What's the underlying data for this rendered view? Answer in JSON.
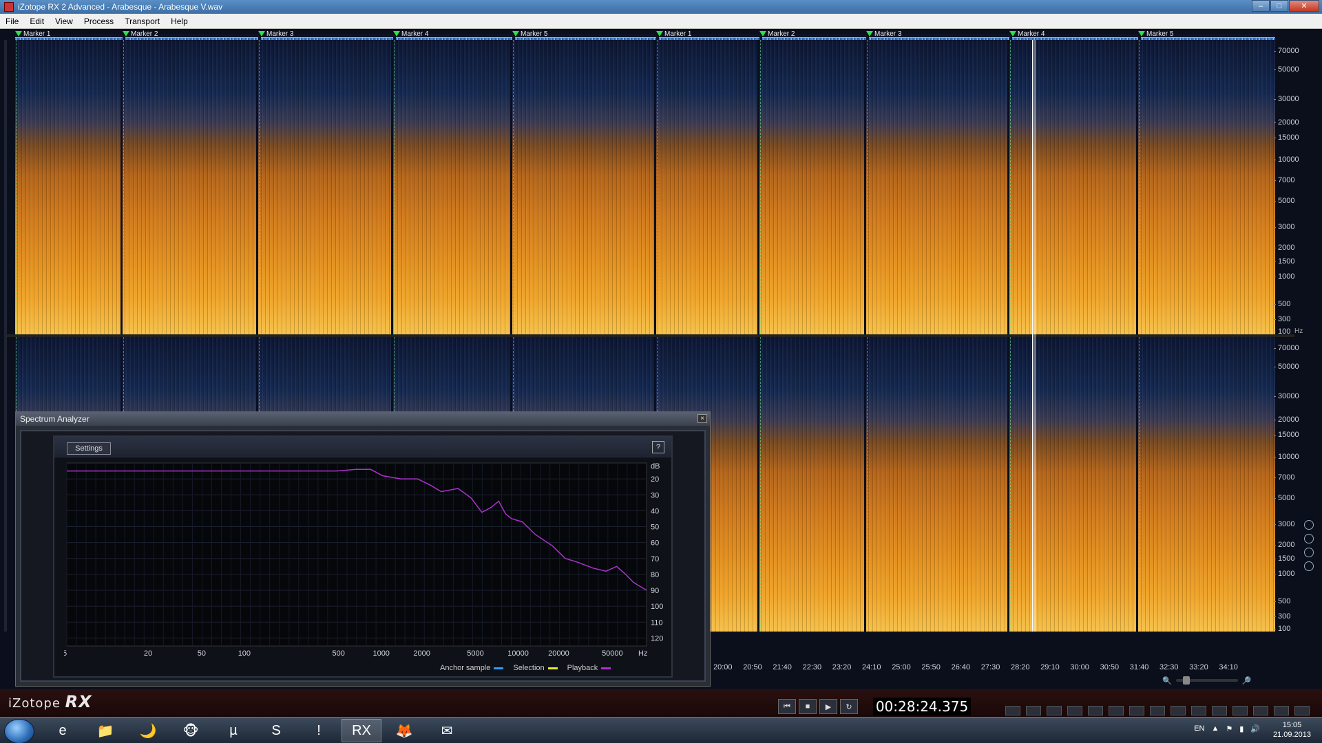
{
  "window": {
    "title": "iZotope RX 2 Advanced - Arabesque - Arabesque V.wav"
  },
  "menu": [
    "File",
    "Edit",
    "View",
    "Process",
    "Transport",
    "Help"
  ],
  "markers": [
    {
      "label": "Marker 1"
    },
    {
      "label": "Marker 2"
    },
    {
      "label": "Marker 3"
    },
    {
      "label": "Marker 4"
    },
    {
      "label": "Marker 5"
    },
    {
      "label": "Marker 1"
    },
    {
      "label": "Marker 2"
    },
    {
      "label": "Marker 3"
    },
    {
      "label": "Marker 4"
    },
    {
      "label": "Marker 5"
    }
  ],
  "freq_scale": [
    "70000",
    "50000",
    "30000",
    "20000",
    "15000",
    "10000",
    "7000",
    "5000",
    "3000",
    "2000",
    "1500",
    "1000",
    "500",
    "300",
    "100"
  ],
  "freq_unit": "Hz",
  "time_ticks": [
    "20:00",
    "20:50",
    "21:40",
    "22:30",
    "23:20",
    "24:10",
    "25:00",
    "25:50",
    "26:40",
    "27:30",
    "28:20",
    "29:10",
    "30:00",
    "30:50",
    "31:40",
    "32:30",
    "33:20",
    "34:10"
  ],
  "spectrum_analyzer": {
    "title": "Spectrum Analyzer",
    "close_label": "×",
    "settings_label": "Settings",
    "help_label": "?",
    "legend": [
      {
        "name": "Anchor sample",
        "color": "#2f9cff"
      },
      {
        "name": "Selection",
        "color": "#e6f02a"
      },
      {
        "name": "Playback",
        "color": "#b030d0"
      }
    ]
  },
  "chart_data": {
    "type": "line",
    "xscale": "log",
    "xlim": [
      5,
      100000
    ],
    "ylim": [
      10,
      125
    ],
    "yinverted": true,
    "xlabel": "Hz",
    "ylabel": "dB",
    "x_ticks": [
      "5",
      "20",
      "50",
      "100",
      "500",
      "1000",
      "2000",
      "5000",
      "10000",
      "20000",
      "50000",
      "Hz"
    ],
    "y_ticks": [
      "dB",
      "20",
      "30",
      "40",
      "50",
      "60",
      "70",
      "80",
      "90",
      "100",
      "110",
      "120"
    ],
    "series": [
      {
        "name": "Playback",
        "color": "#b030d0",
        "x": [
          5,
          50,
          100,
          300,
          500,
          700,
          900,
          1100,
          1500,
          2000,
          2500,
          3000,
          4000,
          5000,
          6000,
          7000,
          8000,
          9000,
          10000,
          12000,
          15000,
          20000,
          25000,
          30000,
          40000,
          50000,
          60000,
          70000,
          80000,
          100000
        ],
        "y": [
          15,
          15,
          15,
          15,
          15,
          14,
          14,
          18,
          20,
          20,
          24,
          28,
          26,
          32,
          41,
          38,
          34,
          42,
          45,
          47,
          55,
          62,
          70,
          72,
          76,
          78,
          75,
          80,
          85,
          90
        ]
      }
    ]
  },
  "transport": {
    "logo_prefix": "iZotope",
    "logo_main": "RX",
    "timecode": "00:28:24.375",
    "buttons": [
      "⏮",
      "■",
      "▶",
      "↻"
    ]
  },
  "taskbar": {
    "apps": [
      "e",
      "📁",
      "🌙",
      "🐵",
      "µ",
      "S",
      "!",
      "RX",
      "🦊",
      "✉"
    ],
    "lang": "EN",
    "time": "15:05",
    "date": "21.09.2013"
  }
}
